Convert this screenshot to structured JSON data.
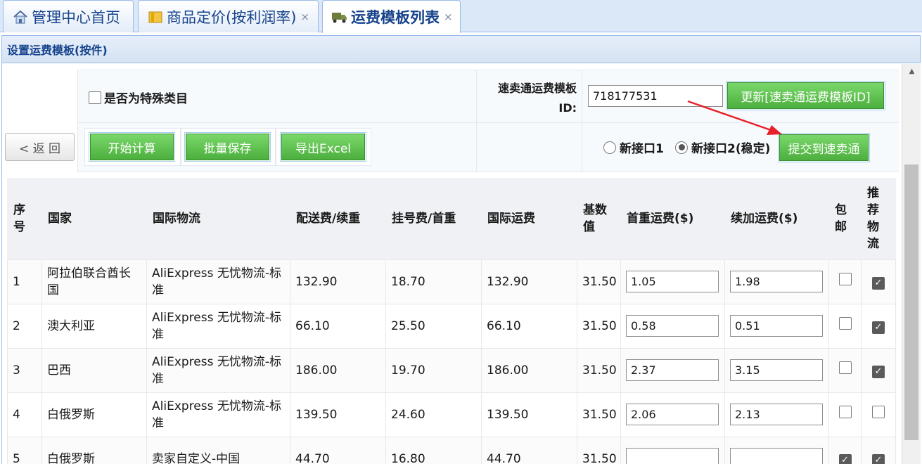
{
  "tabs": [
    {
      "label": "管理中心首页",
      "icon": "home-icon",
      "closable": false,
      "active": false
    },
    {
      "label": "商品定价(按利润率)",
      "icon": "folder-icon",
      "closable": true,
      "active": false
    },
    {
      "label": "运费模板列表",
      "icon": "truck-icon",
      "closable": true,
      "active": true
    }
  ],
  "close_glyph": "×",
  "panel": {
    "title": "设置运费模板(按件)"
  },
  "form": {
    "special_category_label": "是否为特殊类目",
    "special_category_checked": false,
    "template_id_label_line1": "速卖通运费模板",
    "template_id_label_line2": "ID:",
    "template_id_value": "718177531",
    "update_button": "更新[速卖通运费模板ID]",
    "back_button": "< 返 回",
    "calc_button": "开始计算",
    "save_button": "批量保存",
    "export_button": "导出Excel",
    "radio_api1": "新接口1",
    "radio_api2": "新接口2(稳定)",
    "selected_api": "api2",
    "submit_button": "提交到速卖通"
  },
  "table": {
    "headers": {
      "index": [
        "序",
        "号"
      ],
      "country": "国家",
      "logistics": "国际物流",
      "delivery_fee": "配送费/续重",
      "register_fee": "挂号费/首重",
      "intl_fee": "国际运费",
      "base": [
        "基数",
        "值"
      ],
      "first_weight": "首重运费($)",
      "extra_weight": "续加运费($)",
      "free_ship": [
        "包",
        "邮"
      ],
      "recommend": [
        "推",
        "荐",
        "物",
        "流"
      ]
    },
    "rows": [
      {
        "index": "1",
        "country": "阿拉伯联合酋长国",
        "logistics": "AliExpress 无忧物流-标准",
        "delivery_fee": "132.90",
        "register_fee": "18.70",
        "intl_fee": "132.90",
        "base": "31.50",
        "first_weight": "1.05",
        "extra_weight": "1.98",
        "free_ship": false,
        "recommend": true
      },
      {
        "index": "2",
        "country": "澳大利亚",
        "logistics": "AliExpress 无忧物流-标准",
        "delivery_fee": "66.10",
        "register_fee": "25.50",
        "intl_fee": "66.10",
        "base": "31.50",
        "first_weight": "0.58",
        "extra_weight": "0.51",
        "free_ship": false,
        "recommend": true
      },
      {
        "index": "3",
        "country": "巴西",
        "logistics": "AliExpress 无忧物流-标准",
        "delivery_fee": "186.00",
        "register_fee": "19.70",
        "intl_fee": "186.00",
        "base": "31.50",
        "first_weight": "2.37",
        "extra_weight": "3.15",
        "free_ship": false,
        "recommend": true
      },
      {
        "index": "4",
        "country": "白俄罗斯",
        "logistics": "AliExpress 无忧物流-标准",
        "delivery_fee": "139.50",
        "register_fee": "24.60",
        "intl_fee": "139.50",
        "base": "31.50",
        "first_weight": "2.06",
        "extra_weight": "2.13",
        "free_ship": false,
        "recommend": false
      },
      {
        "index": "5",
        "country": "白俄罗斯",
        "logistics": "卖家自定义-中国",
        "delivery_fee": "44.70",
        "register_fee": "16.80",
        "intl_fee": "44.70",
        "base": "31.50",
        "first_weight": "",
        "extra_weight": "",
        "free_ship": true,
        "recommend": true
      }
    ]
  },
  "colors": {
    "accent": "#15428b",
    "green_button": "#4caf3e",
    "arrow": "#e8202a"
  }
}
